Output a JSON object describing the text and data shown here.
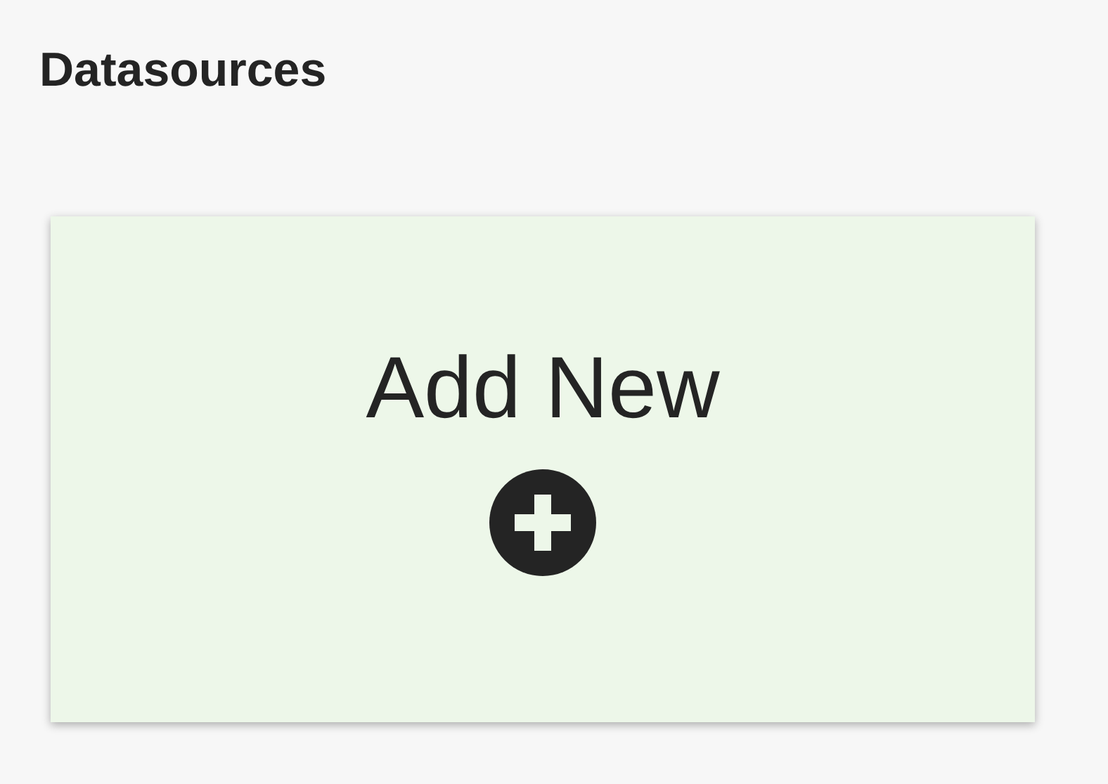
{
  "title": "Datasources",
  "add_card": {
    "label": "Add New"
  }
}
